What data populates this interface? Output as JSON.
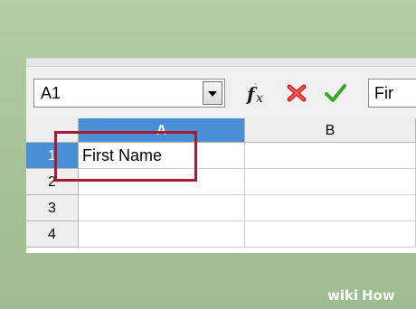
{
  "name_box": {
    "value": "A1"
  },
  "formula_bar": {
    "value": "Fir",
    "function_icon": "fx-icon",
    "cancel_icon": "cancel-icon",
    "accept_icon": "accept-icon"
  },
  "columns": [
    {
      "label": "A",
      "selected": true
    },
    {
      "label": "B",
      "selected": false
    }
  ],
  "rows": [
    {
      "label": "1",
      "selected": true,
      "cells": [
        "First Name",
        ""
      ]
    },
    {
      "label": "2",
      "selected": false,
      "cells": [
        "",
        ""
      ]
    },
    {
      "label": "3",
      "selected": false,
      "cells": [
        "",
        ""
      ]
    },
    {
      "label": "4",
      "selected": false,
      "cells": [
        "",
        ""
      ]
    }
  ],
  "colors": {
    "selection_header": "#4a8ed6",
    "highlight_box": "#a31c33",
    "background": "#a9c49a",
    "cancel": "#d42020",
    "accept": "#3aa62a"
  },
  "watermark": {
    "brand_prefix": "wiki",
    "brand_suffix": "How"
  }
}
